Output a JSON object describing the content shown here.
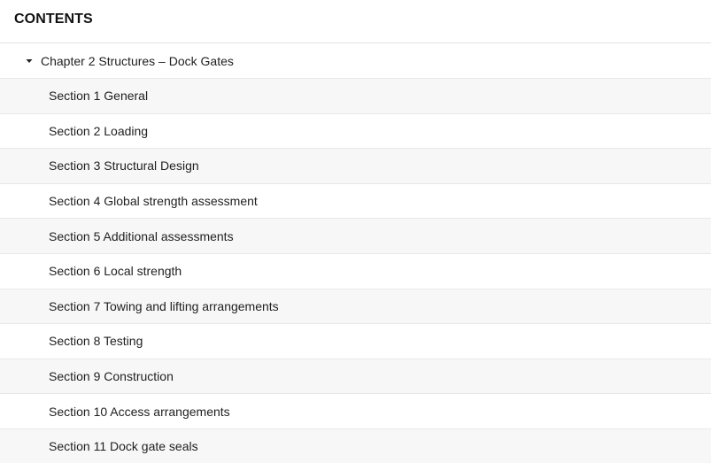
{
  "header": {
    "title": "CONTENTS"
  },
  "chapter": {
    "label": "Chapter 2 Structures – Dock Gates",
    "caret_icon": "caret-down-icon"
  },
  "sections": [
    {
      "label": "Section 1 General"
    },
    {
      "label": "Section 2 Loading"
    },
    {
      "label": "Section 3 Structural Design"
    },
    {
      "label": "Section 4 Global strength assessment"
    },
    {
      "label": "Section 5 Additional assessments"
    },
    {
      "label": "Section 6 Local strength"
    },
    {
      "label": "Section 7 Towing and lifting arrangements"
    },
    {
      "label": "Section 8 Testing"
    },
    {
      "label": "Section 9 Construction"
    },
    {
      "label": "Section 10 Access arrangements"
    },
    {
      "label": "Section 11 Dock gate seals"
    }
  ],
  "colors": {
    "row_alt": "#f7f7f7",
    "divider": "#e8e8e8",
    "text": "#1f1f1f"
  }
}
